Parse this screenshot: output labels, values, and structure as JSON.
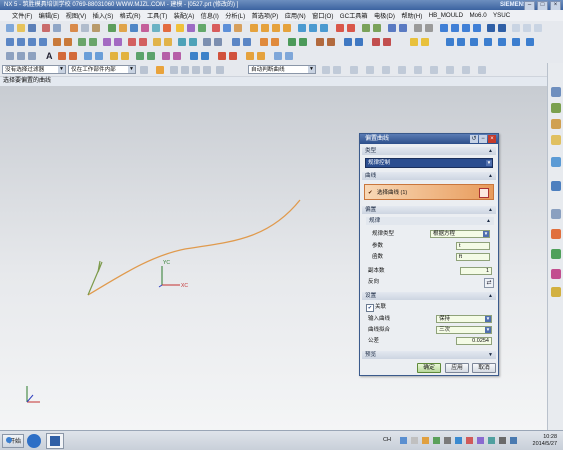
{
  "window": {
    "title": "NX 5 - 筑胜模具培训学校  0769-88031060  WWW.MJZL.COM - 建模 - [0527.prt (修改的) ]",
    "brand": "SIEMENS"
  },
  "menu": [
    "文件(F)",
    "编辑(E)",
    "视图(V)",
    "插入(S)",
    "格式(R)",
    "工具(T)",
    "装配(A)",
    "信息(I)",
    "分析(L)",
    "首选项(P)",
    "应用(N)",
    "窗口(O)",
    "GC工具箱",
    "电极(D)",
    "帮助(H)",
    "HB_MOULD",
    "Mo6.0",
    "YSUC"
  ],
  "toolbar": {
    "text_icon": "A"
  },
  "filters": {
    "select_filter": "没有选择过滤器",
    "scope": "仅在工作部件内部",
    "snap": "自动判断曲线"
  },
  "cue": "选择要偏置的曲线",
  "axes": {
    "xc": "XC",
    "yc": "YC"
  },
  "dialog": {
    "title": "偏置曲线",
    "type_header": "类型",
    "type_value": "规律控制",
    "curve_header": "曲线",
    "select_curve": "选择曲线 (1)",
    "offset_header": "偏置",
    "law_header": "规律",
    "law_type_label": "规律类型",
    "law_type_value": "根据方程",
    "param_label": "参数",
    "param_value": "t",
    "function_label": "函数",
    "function_value": "ft",
    "copies_label": "副本数",
    "copies_value": "1",
    "reverse_label": "反向",
    "settings_header": "设置",
    "associative_label": "关联",
    "input_curve_label": "输入曲线",
    "input_curve_value": "保持",
    "fit_label": "曲线拟合",
    "fit_value": "三次",
    "tolerance_label": "公差",
    "tolerance_value": "0.0254",
    "preview_header": "预览",
    "ok": "确定",
    "apply": "应用",
    "cancel": "取消"
  },
  "taskbar": {
    "start": "开始",
    "tray": "CH",
    "time": "10:28",
    "date": "2014/5/27"
  }
}
